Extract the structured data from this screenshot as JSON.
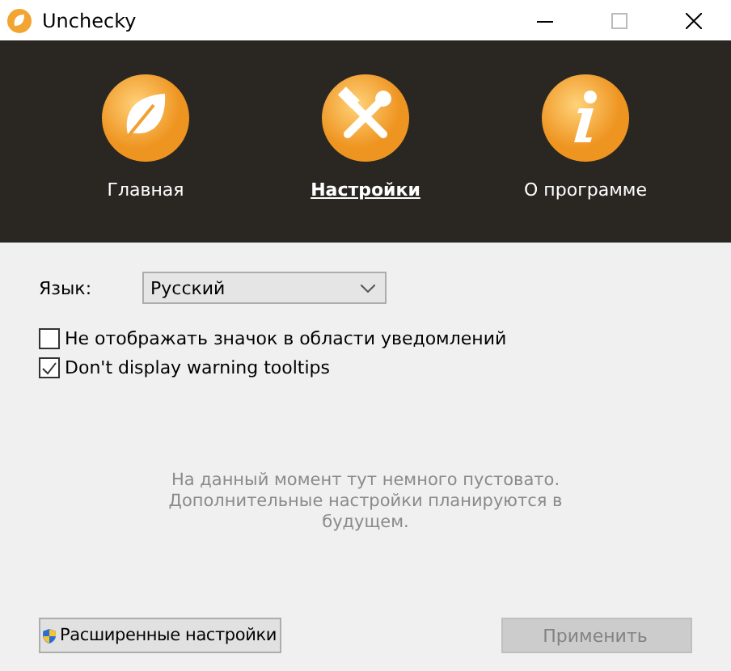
{
  "window": {
    "title": "Unchecky"
  },
  "nav": [
    {
      "label": "Главная",
      "kind": "leaf",
      "selected": false
    },
    {
      "label": "Настройки",
      "kind": "tools",
      "selected": true
    },
    {
      "label": "О программе",
      "kind": "info",
      "selected": false
    }
  ],
  "language": {
    "label": "Язык:",
    "value": "Русский"
  },
  "options": [
    {
      "label": "Не отображать значок в области уведомлений",
      "checked": false
    },
    {
      "label": "Don't display warning tooltips",
      "checked": true
    }
  ],
  "message": "На данный момент тут немного пустовато. Дополнительные настройки планируются в будущем.",
  "buttons": [
    {
      "label": "Расширенные настройки",
      "kind": "shield",
      "disabled": false
    },
    {
      "label": "Применить",
      "kind": "plain",
      "disabled": true
    }
  ]
}
